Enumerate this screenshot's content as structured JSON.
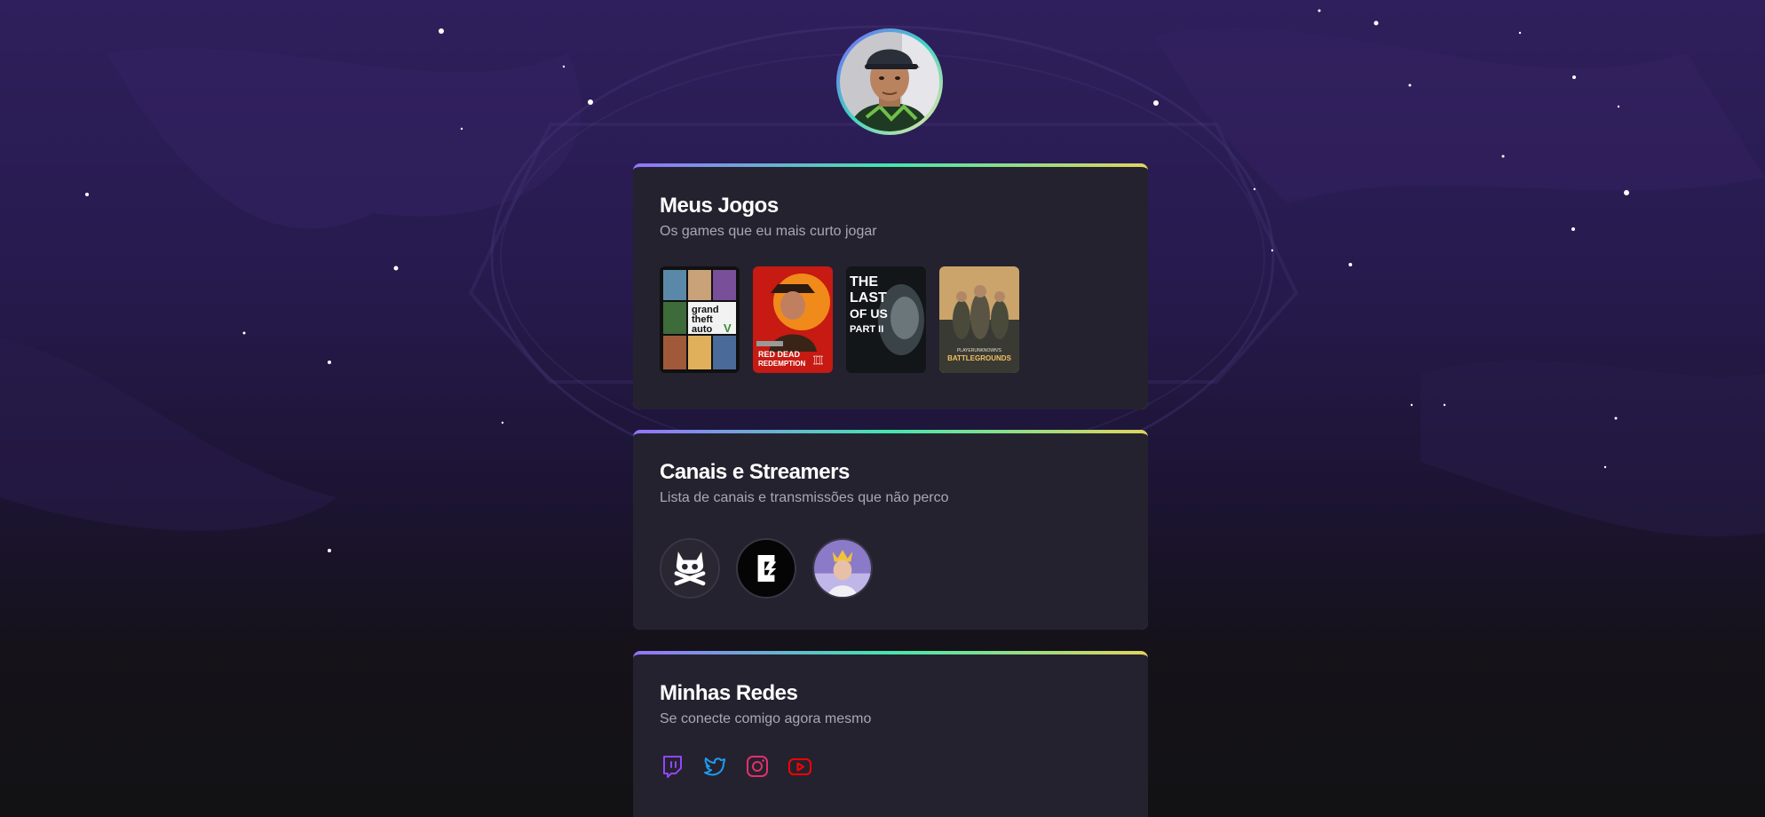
{
  "profile": {
    "avatar_alt": "Foto de perfil"
  },
  "games_section": {
    "title": "Meus Jogos",
    "subtitle": "Os games que eu mais curto jogar",
    "games": [
      {
        "name": "Grand Theft Auto V",
        "cover_lines": [
          "grand",
          "theft",
          "auto"
        ],
        "cover_mark": "V"
      },
      {
        "name": "Red Dead Redemption II",
        "cover_lines": [
          "RED DEAD",
          "REDEMPTION"
        ],
        "cover_mark": "II"
      },
      {
        "name": "The Last of Us Part II",
        "cover_lines": [
          "THE",
          "LAST",
          "OF US",
          "PART II"
        ]
      },
      {
        "name": "PlayerUnknown's Battlegrounds",
        "cover_lines": [
          "PLAYERUNKNOWN'S",
          "BATTLEGROUNDS"
        ]
      }
    ]
  },
  "streamers_section": {
    "title": "Canais e Streamers",
    "subtitle": "Lista de canais e transmissões que não perco",
    "streamers": [
      {
        "icon": "skull-crossbones-cat-icon"
      },
      {
        "icon": "lightning-c-logo-icon"
      },
      {
        "icon": "streamer-crown-avatar"
      }
    ]
  },
  "social_section": {
    "title": "Minhas Redes",
    "subtitle": "Se conecte comigo agora mesmo",
    "links": [
      {
        "network": "twitch",
        "icon": "twitch-icon",
        "color": "#9146ff"
      },
      {
        "network": "twitter",
        "icon": "twitter-icon",
        "color": "#1d9bf0"
      },
      {
        "network": "instagram",
        "icon": "instagram-icon",
        "color": "#e1306c"
      },
      {
        "network": "youtube",
        "icon": "youtube-icon",
        "color": "#ff0000"
      }
    ]
  },
  "colors": {
    "card_bg": "#25222f",
    "title": "#ffffff",
    "subtitle": "#a8a8b3",
    "accent_gradient": [
      "#9572fc",
      "#43e7ad",
      "#e2d45c"
    ]
  }
}
